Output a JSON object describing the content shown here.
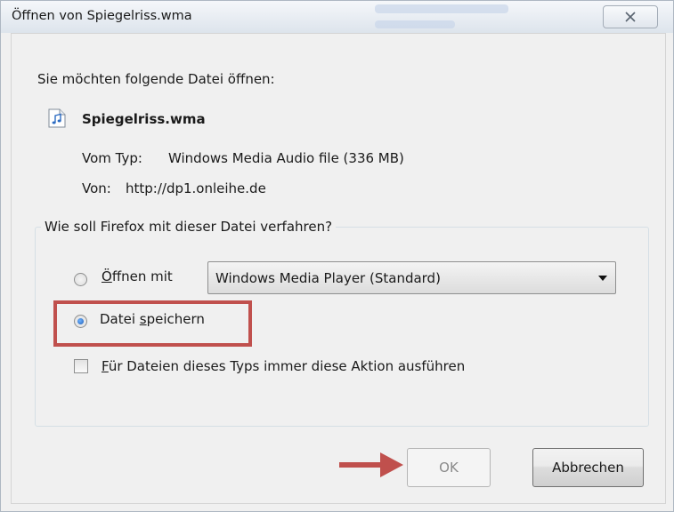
{
  "window": {
    "title": "Öffnen von Spiegelriss.wma"
  },
  "intro": {
    "text": "Sie möchten folgende Datei öffnen:"
  },
  "file": {
    "name": "Spiegelriss.wma",
    "icon": "audio-file-icon",
    "type_label": "Vom Typ:",
    "type_value": "Windows Media Audio file (336 MB)",
    "from_label": "Von:",
    "from_value": "http://dp1.onleihe.de"
  },
  "action": {
    "question": "Wie soll Firefox mit dieser Datei verfahren?",
    "open_with_prefix": "Ö",
    "open_with_rest": "ffnen mit",
    "open_with_selected": false,
    "application": "Windows Media Player (Standard)",
    "save_prefix": "Datei ",
    "save_accel": "s",
    "save_rest": "peichern",
    "save_selected": true,
    "always_accel": "F",
    "always_rest": "ür Dateien dieses Typs immer diese Aktion ausführen",
    "always_checked": false
  },
  "buttons": {
    "ok": "OK",
    "cancel": "Abbrechen"
  },
  "annotations": {
    "highlight_color": "#c0504d",
    "arrow_color": "#c0504d"
  }
}
